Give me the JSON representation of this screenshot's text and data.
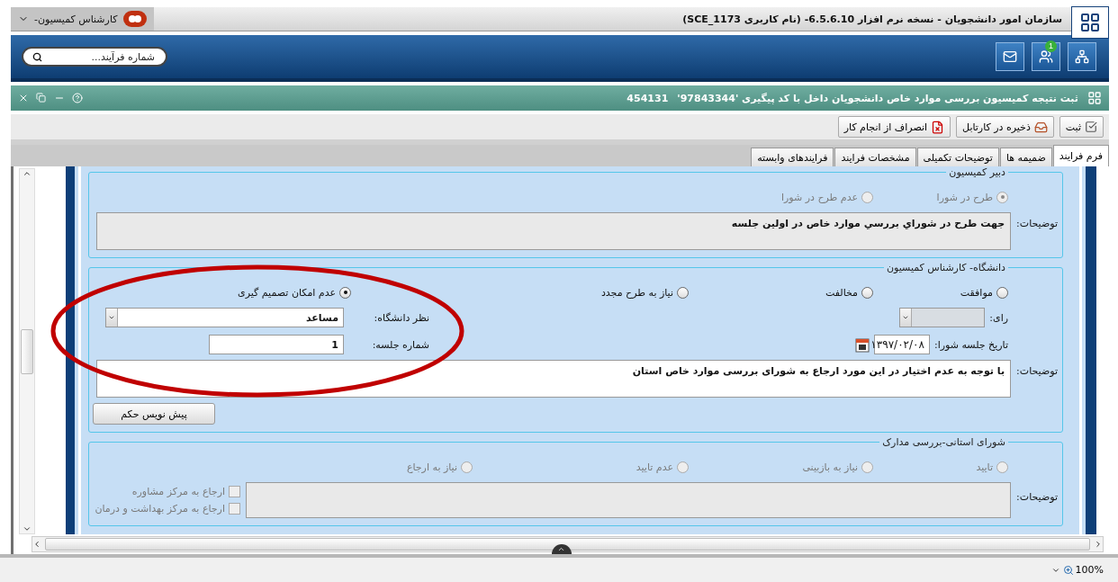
{
  "app_bar": {
    "title": "سازمان امور دانشجویان  -  نسخه نرم افزار  6.5.6.10- (نام کاربری  SCE_1173)",
    "role": "کارشناس کمیسیون-"
  },
  "nav_bar": {
    "search": {
      "placeholder": "شماره فرآیند..."
    },
    "notification_badge": "1"
  },
  "form_header": {
    "title": "ثبت نتیجه کمیسیون بررسی موارد خاص دانشجویان داخل با کد پیگیری  '97843344'",
    "code": "454131"
  },
  "toolbar": [
    {
      "kind": "submit",
      "label": "ثبت"
    },
    {
      "kind": "save",
      "label": "ذخیره در کارتابل"
    },
    {
      "kind": "cancel",
      "label": "انصراف از انجام کار"
    }
  ],
  "tabs": [
    {
      "label": "فرم فرایند",
      "selected": true
    },
    {
      "label": "ضمیمه ها",
      "selected": false
    },
    {
      "label": "توضیحات تکمیلی",
      "selected": false
    },
    {
      "label": "مشخصات فرایند",
      "selected": false
    },
    {
      "label": "فرایندهای وابسته",
      "selected": false
    }
  ],
  "secretary_section": {
    "legend": "دبیر کمیسیون",
    "options": [
      {
        "label": "طرح در شورا",
        "selected": true,
        "disabled": true
      },
      {
        "label": "عدم طرح در شورا",
        "selected": false,
        "disabled": true
      }
    ],
    "notes": {
      "label": "توضیحات:",
      "value": "جهت طرح در شوراي بررسي موارد خاص در اولين جلسه",
      "disabled": true
    }
  },
  "university_section": {
    "legend": "دانشگاه- کارشناس کمیسیون",
    "options": [
      {
        "label": "موافقت",
        "selected": false,
        "disabled": false
      },
      {
        "label": "مخالفت",
        "selected": false,
        "disabled": false
      },
      {
        "label": "نیاز به طرح مجدد",
        "selected": false,
        "disabled": false
      },
      {
        "label": "عدم امکان تصمیم گیری",
        "selected": true,
        "disabled": false
      }
    ],
    "vote": {
      "label": "رای:",
      "disabled": true
    },
    "opinion": {
      "label": "نظر دانشگاه:",
      "value": "مساعد"
    },
    "meeting_date": {
      "label": "تاریخ جلسه شورا:",
      "value": "۱۳۹۷/۰۲/۰۸"
    },
    "meeting_number": {
      "label": "شماره جلسه:",
      "value": "1"
    },
    "notes": {
      "label": "توضیحات:",
      "value": "با توجه به عدم اختیار در این مورد ارجاع به شورای بررسی موارد خاص استان",
      "disabled": false
    },
    "draft_button": "پیش نویس حکم"
  },
  "provincial_section": {
    "legend": "شورای استانی-بررسی مدارک",
    "options": [
      {
        "label": "تایید",
        "selected": false,
        "disabled": true
      },
      {
        "label": "نیاز به بازبینی",
        "selected": false,
        "disabled": true
      },
      {
        "label": "عدم تایید",
        "selected": false,
        "disabled": true
      },
      {
        "label": "نیاز به ارجاع",
        "selected": false,
        "disabled": true
      }
    ],
    "notes": {
      "label": "توضیحات:",
      "disabled": true
    },
    "referrals": [
      {
        "label": "ارجاع به مرکز مشاوره",
        "checked": false,
        "disabled": true
      },
      {
        "label": "ارجاع به مرکز بهداشت و درمان",
        "checked": false,
        "disabled": true
      }
    ]
  },
  "status_bar": {
    "zoom": "100%"
  }
}
